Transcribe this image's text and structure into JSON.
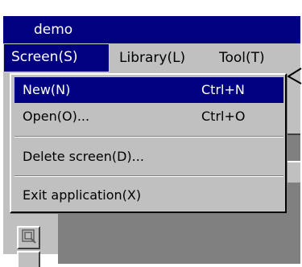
{
  "window": {
    "title": "demo"
  },
  "menubar": {
    "items": [
      {
        "label": "Screen(S)",
        "active": true
      },
      {
        "label": "Library(L)"
      },
      {
        "label": "Tool(T)"
      }
    ]
  },
  "screen_menu": {
    "items": [
      {
        "label": "New(N)",
        "shortcut": "Ctrl+N",
        "selected": true
      },
      {
        "label": "Open(O)...",
        "shortcut": "Ctrl+O"
      },
      {
        "label": "Delete screen(D)..."
      },
      {
        "label": "Exit application(X)"
      }
    ]
  },
  "colors": {
    "title_bar": "#000080",
    "selection": "#000080",
    "face": "#c0c0c0",
    "workspace": "#808080"
  },
  "icons": {
    "toolbar_button": "document-tool-icon",
    "cursor": "arrow-cursor-icon"
  }
}
